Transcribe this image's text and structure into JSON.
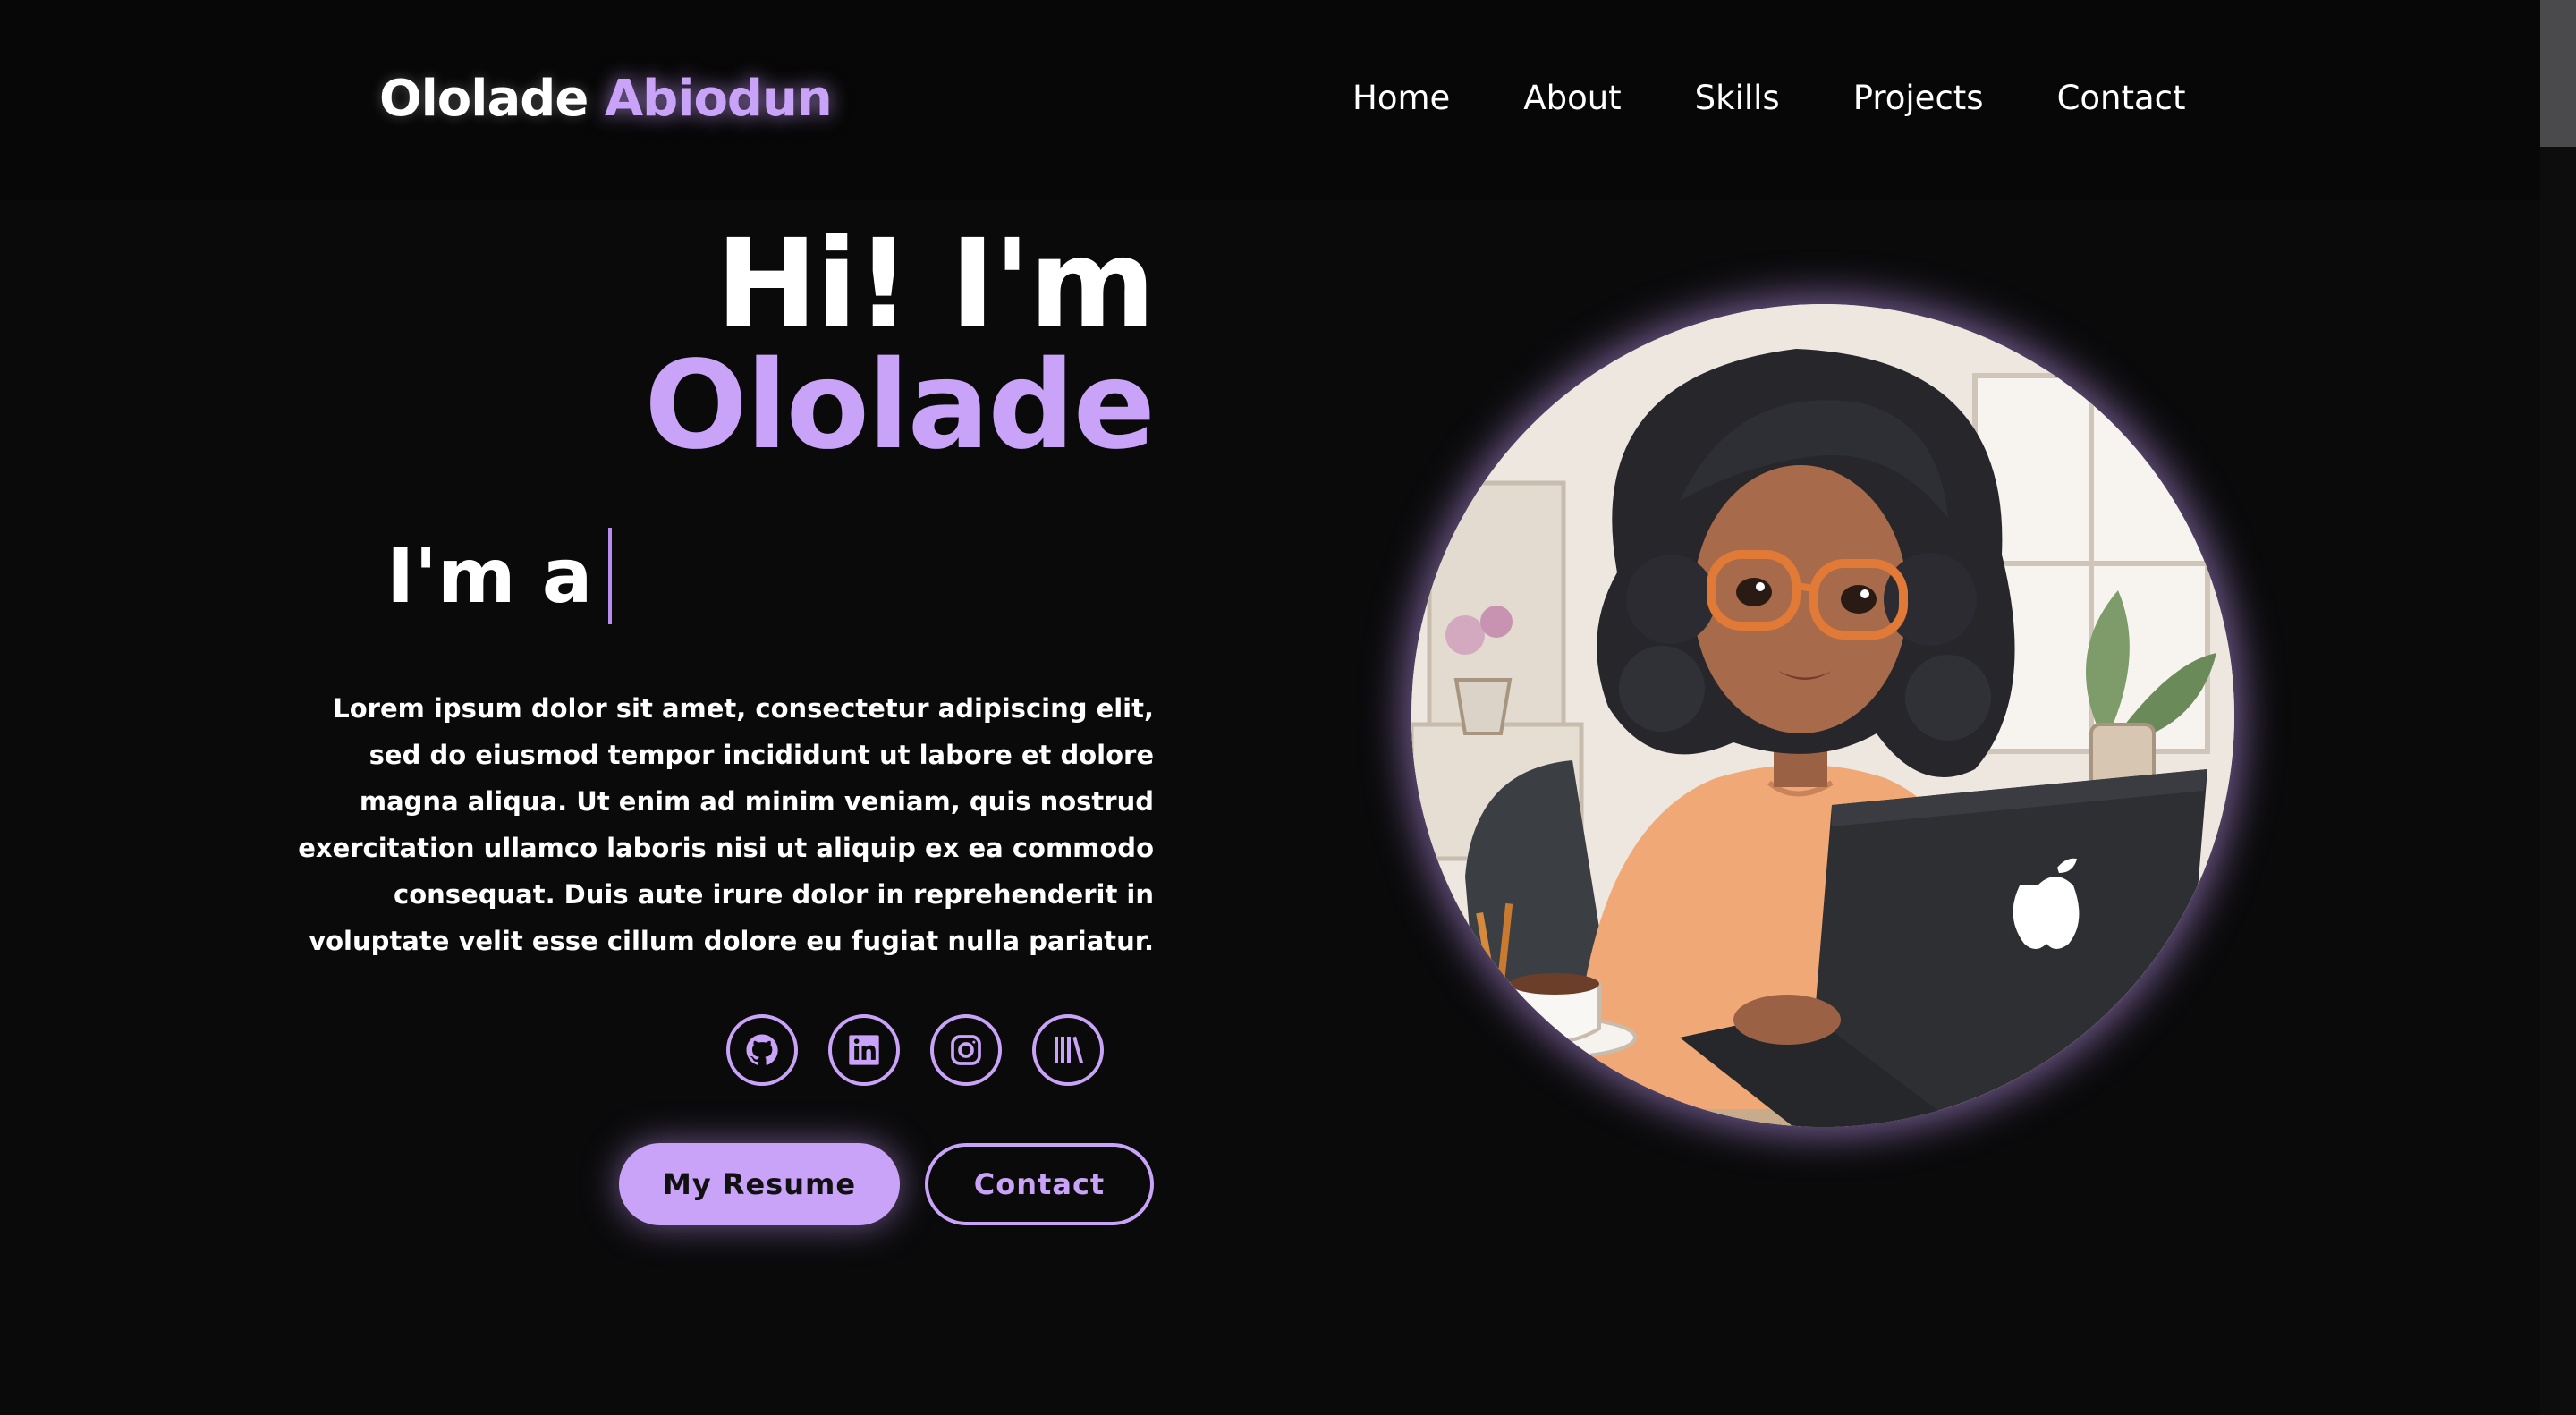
{
  "brand": {
    "first_name": "Ololade",
    "last_name": "Abiodun"
  },
  "nav": {
    "items": [
      {
        "label": "Home"
      },
      {
        "label": "About"
      },
      {
        "label": "Skills"
      },
      {
        "label": "Projects"
      },
      {
        "label": "Contact"
      }
    ]
  },
  "hero": {
    "greeting": "Hi! I'm",
    "name": "Ololade",
    "typing_prefix": "I'm a",
    "bio": "Lorem ipsum dolor sit amet, consectetur adipiscing elit, sed do eiusmod tempor incididunt ut labore et dolore magna aliqua. Ut enim ad minim veniam, quis nostrud exercitation ullamco laboris nisi ut aliquip ex ea commodo consequat. Duis aute irure dolor in reprehenderit in voluptate velit esse cillum dolore eu fugiat nulla pariatur.",
    "socials": [
      {
        "icon": "github-icon"
      },
      {
        "icon": "linkedin-icon"
      },
      {
        "icon": "instagram-icon"
      },
      {
        "icon": "library-icon"
      }
    ],
    "buttons": {
      "resume": "My Resume",
      "contact": "Contact"
    }
  },
  "colors": {
    "accent": "#c9a3f7",
    "background": "#0a0a0b",
    "text": "#ffffff"
  }
}
